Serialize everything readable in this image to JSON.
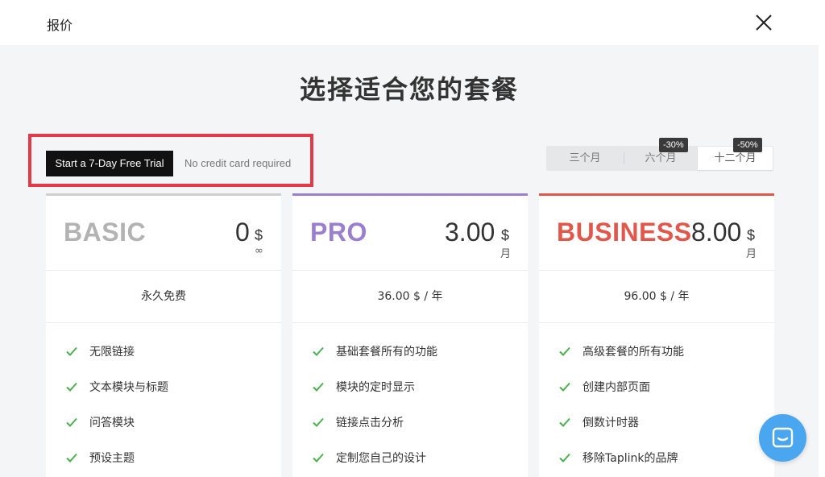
{
  "header": {
    "title": "报价"
  },
  "heading": "选择适合您的套餐",
  "trial": {
    "button_label": "Start a 7-Day Free Trial",
    "note": "No credit card required"
  },
  "periods": [
    {
      "label": "三个月",
      "badge": ""
    },
    {
      "label": "六个月",
      "badge": "-30%"
    },
    {
      "label": "十二个月",
      "badge": "-50%",
      "selected": true
    }
  ],
  "plans": [
    {
      "name": "BASIC",
      "price": "0",
      "currency": "$",
      "unit": "∞",
      "subtitle": "永久免费",
      "color": "#b3b3b3",
      "features": [
        "无限链接",
        "文本模块与标题",
        "问答模块",
        "预设主题"
      ]
    },
    {
      "name": "PRO",
      "price": "3.00",
      "currency": "$",
      "unit": "月",
      "subtitle": "36.00 $ / 年",
      "color": "#9a7fd1",
      "features": [
        "基础套餐所有的功能",
        "模块的定时显示",
        "链接点击分析",
        "定制您自己的设计"
      ]
    },
    {
      "name": "BUSINESS",
      "price": "8.00",
      "currency": "$",
      "unit": "月",
      "subtitle": "96.00 $ / 年",
      "color": "#e2574c",
      "features": [
        "高级套餐的所有功能",
        "创建内部页面",
        "倒数计时器",
        "移除Taplink的品牌"
      ]
    }
  ],
  "colors": {
    "check": "#4caf50",
    "chat": "#4aa6ee",
    "highlight": "#e23b47"
  },
  "icons": {
    "close": "close-icon",
    "check": "check-icon",
    "chat": "chat-icon"
  }
}
